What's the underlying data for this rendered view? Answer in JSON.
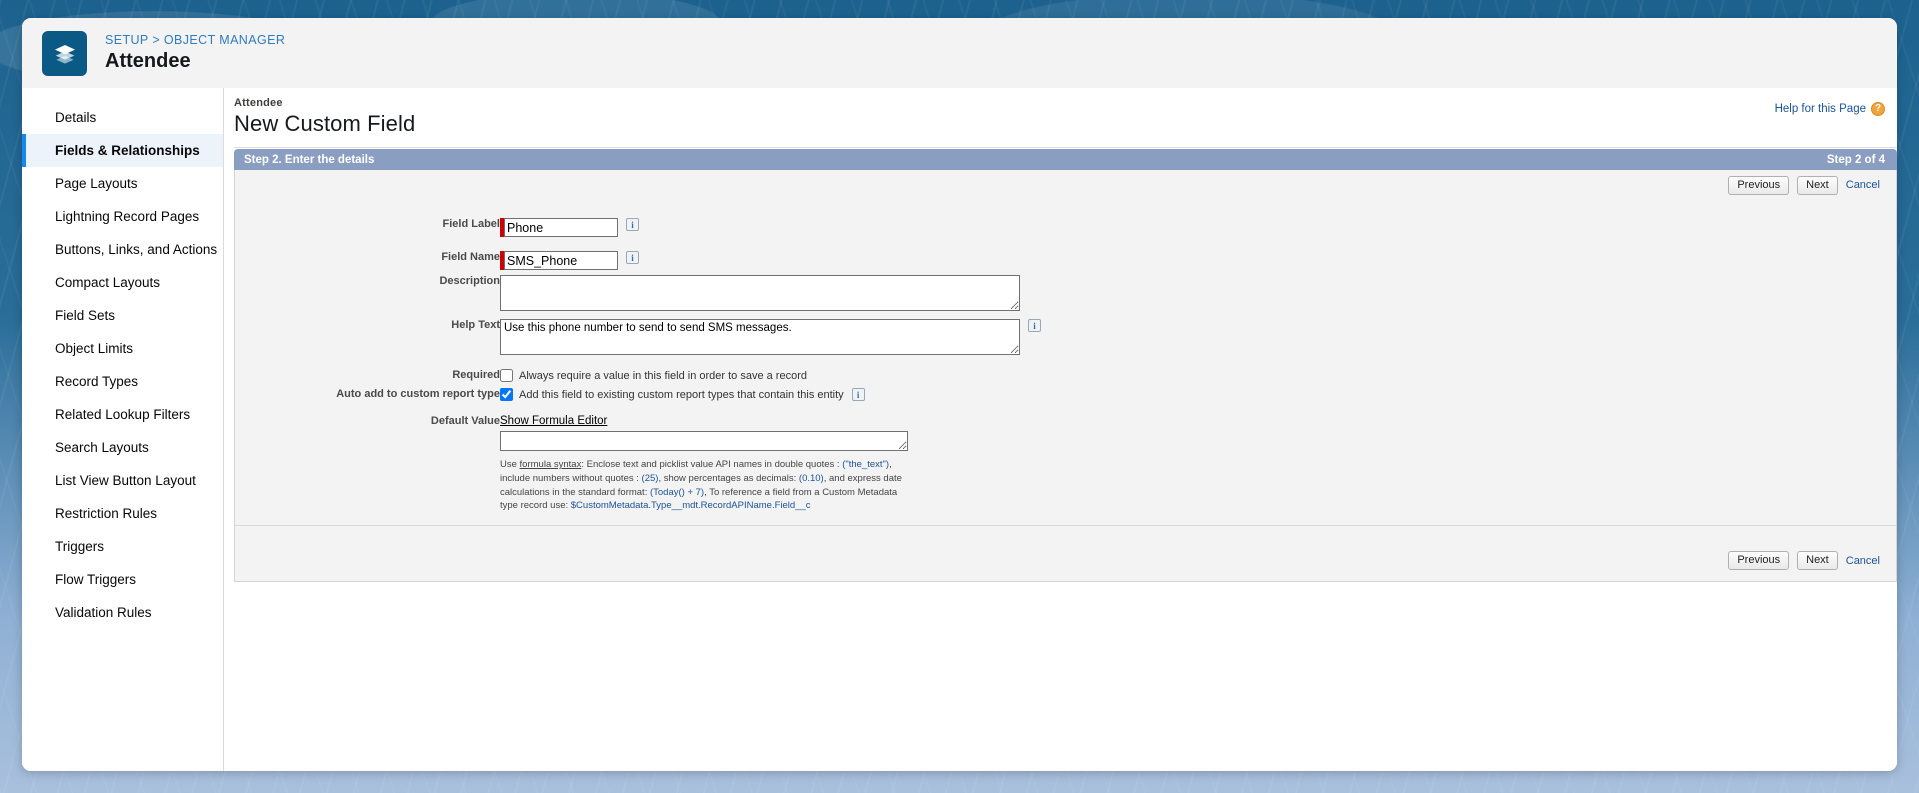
{
  "header": {
    "app_icon_name": "object-manager-stack-icon",
    "breadcrumb": "SETUP > OBJECT MANAGER",
    "object_title": "Attendee"
  },
  "sidebar": {
    "items": [
      {
        "label": "Details",
        "active": false
      },
      {
        "label": "Fields & Relationships",
        "active": true
      },
      {
        "label": "Page Layouts",
        "active": false
      },
      {
        "label": "Lightning Record Pages",
        "active": false
      },
      {
        "label": "Buttons, Links, and Actions",
        "active": false
      },
      {
        "label": "Compact Layouts",
        "active": false
      },
      {
        "label": "Field Sets",
        "active": false
      },
      {
        "label": "Object Limits",
        "active": false
      },
      {
        "label": "Record Types",
        "active": false
      },
      {
        "label": "Related Lookup Filters",
        "active": false
      },
      {
        "label": "Search Layouts",
        "active": false
      },
      {
        "label": "List View Button Layout",
        "active": false
      },
      {
        "label": "Restriction Rules",
        "active": false
      },
      {
        "label": "Triggers",
        "active": false
      },
      {
        "label": "Flow Triggers",
        "active": false
      },
      {
        "label": "Validation Rules",
        "active": false
      }
    ]
  },
  "page": {
    "eyebrow": "Attendee",
    "title": "New Custom Field",
    "help_link": "Help for this Page",
    "help_badge": "?"
  },
  "wizard": {
    "step_title": "Step 2. Enter the details",
    "step_counter": "Step 2 of 4",
    "previous_label": "Previous",
    "next_label": "Next",
    "cancel_label": "Cancel"
  },
  "form": {
    "field_label": {
      "label": "Field Label",
      "value": "Phone",
      "info_icon": "info-icon",
      "required": true
    },
    "field_name": {
      "label": "Field Name",
      "value": "SMS_Phone",
      "info_icon": "info-icon",
      "required": true
    },
    "description": {
      "label": "Description",
      "value": "",
      "placeholder": ""
    },
    "help_text": {
      "label": "Help Text",
      "value": "Use this phone number to send to send SMS messages.",
      "info_icon": "info-icon"
    },
    "required": {
      "label": "Required",
      "checkbox_label": "Always require a value in this field in order to save a record",
      "checked": false
    },
    "auto_add_report_type": {
      "label": "Auto add to custom report type",
      "checkbox_label": "Add this field to existing custom report types that contain this entity",
      "checked": true,
      "info_icon": "info-icon"
    },
    "default_value": {
      "label": "Default Value",
      "formula_editor_link": "Show Formula Editor",
      "value": "",
      "hint": {
        "lead": "Use ",
        "syntax_word": "formula syntax",
        "p1": ": Enclose text and picklist value API names in double quotes : ",
        "code1": "(\"the_text\")",
        "p2": ", include numbers without quotes : ",
        "code2": "(25)",
        "p3": ", show percentages as decimals: ",
        "code3": "(0.10)",
        "p4": ", and express date calculations in the standard format: ",
        "code4": "(Today() + 7)",
        "p5": ", To reference a field from a Custom Metadata type record use: ",
        "code5": "$CustomMetadata.Type__mdt.RecordAPIName.Field__c"
      }
    }
  },
  "colors": {
    "brand_blue": "#1b5f91",
    "accent_blue": "#1589ee",
    "step_bar": "#8a9ec1",
    "required_red": "#cc0000",
    "link_blue": "#1b5297",
    "panel_gray": "#f3f3f3"
  }
}
